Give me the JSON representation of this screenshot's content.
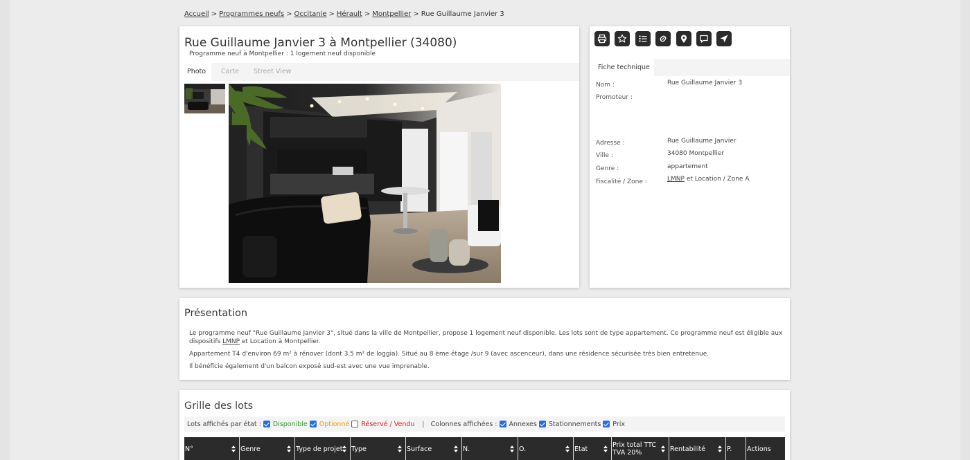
{
  "breadcrumb": {
    "items": [
      "Accueil",
      "Programmes neufs",
      "Occitanie",
      "Hérault",
      "Montpellier"
    ],
    "current": "Rue Guillaume Janvier 3",
    "separator": ">"
  },
  "program": {
    "title": "Rue Guillaume Janvier 3 à Montpellier (34080)",
    "subtitle": "Programme neuf à Montpellier : 1 logement neuf disponible",
    "media_tabs": [
      "Photo",
      "Carte",
      "Street View"
    ]
  },
  "toolbar": {
    "icons": [
      "print-icon",
      "star-icon",
      "list-icon",
      "attachment-icon",
      "map-pin-icon",
      "chat-icon",
      "send-icon"
    ]
  },
  "fiche": {
    "tab_label": "Fiche technique",
    "nom_label": "Nom :",
    "nom_value": "Rue Guillaume Janvier 3",
    "promoteur_label": "Promoteur :",
    "adresse_label": "Adresse :",
    "adresse_value": "Rue Guillaume Janvier",
    "ville_label": "Ville :",
    "ville_value": "34080 Montpellier",
    "genre_label": "Genre :",
    "genre_value": "appartement",
    "fiscalite_label": "Fiscalité / Zone :",
    "fiscalite_link": "LMNP",
    "fiscalite_rest": " et Location / Zone A"
  },
  "presentation": {
    "title": "Présentation",
    "p1_text": "Le programme neuf \"Rue Guillaume Janvier 3\", situé dans la ville de Montpellier, propose 1 logement neuf disponible. Les lots sont de type appartement. Ce programme neuf est éligible aux dispositifs ",
    "p1_link": "LMNP",
    "p1_end": " et Location à Montpellier.",
    "p2": "Appartement T4 d'environ 69 m² à rénover (dont 3.5 m² de loggia). Situé au 8 ème étage /sur 9 (avec ascenceur), dans une résidence sécurisée très bien entretenue.",
    "p3": "Il bénéficie également d'un balcon exposé sud-est avec une vue imprenable."
  },
  "grille": {
    "title": "Grille des lots",
    "filter_label": "Lots affichés par état :",
    "disponible": "Disponible",
    "optionne": "Optionné",
    "reserve": "Réservé / Vendu",
    "columns_label": "Colonnes affichées :",
    "annexes": "Annexes",
    "stationnements": "Stationnements",
    "prix": "Prix",
    "headers": [
      "N°",
      "Genre",
      "Type de projet",
      "Type",
      "Surface",
      "N.",
      "O.",
      "Etat",
      "Prix total TTC TVA 20%",
      "Rentabilité",
      "P.",
      "Actions"
    ]
  },
  "colors": {
    "accent_dark": "#2b2b2b",
    "checkbox_blue": "#2a6fd8",
    "status_green": "#2a9a2a",
    "status_orange": "#e8a000",
    "status_red": "#e02020"
  }
}
